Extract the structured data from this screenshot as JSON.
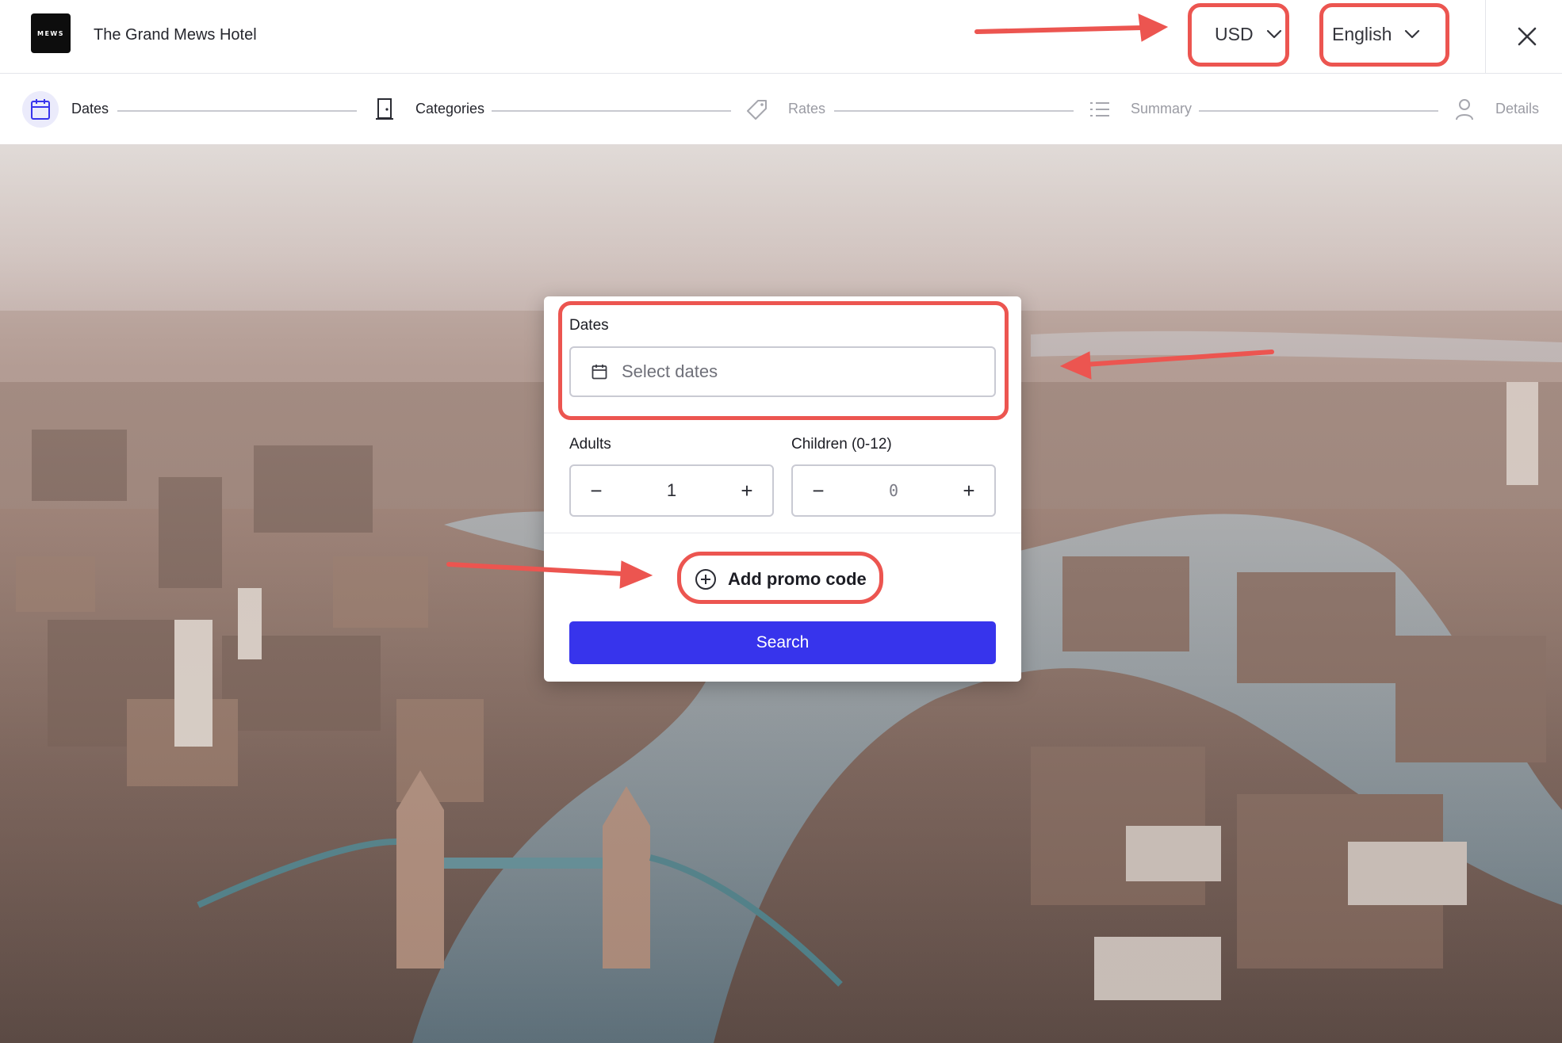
{
  "header": {
    "logo_text": "MEWS",
    "hotel_name": "The Grand Mews Hotel",
    "currency": "USD",
    "language": "English",
    "close_icon": "close-icon"
  },
  "stepper": {
    "steps": [
      {
        "label": "Dates",
        "icon": "calendar-icon",
        "state": "active"
      },
      {
        "label": "Categories",
        "icon": "door-icon",
        "state": "done"
      },
      {
        "label": "Rates",
        "icon": "tag-icon",
        "state": "inactive"
      },
      {
        "label": "Summary",
        "icon": "list-icon",
        "state": "inactive"
      },
      {
        "label": "Details",
        "icon": "user-icon",
        "state": "inactive"
      }
    ]
  },
  "form": {
    "dates_label": "Dates",
    "dates_placeholder": "Select dates",
    "adults_label": "Adults",
    "adults_value": "1",
    "children_label": "Children (0-12)",
    "children_value": "0",
    "minus_symbol": "−",
    "plus_symbol": "+",
    "promo_label": "Add promo code",
    "search_label": "Search"
  },
  "colors": {
    "primary": "#3734ec",
    "annotation": "#ec5550",
    "active_step_bg": "#ebebfb"
  }
}
